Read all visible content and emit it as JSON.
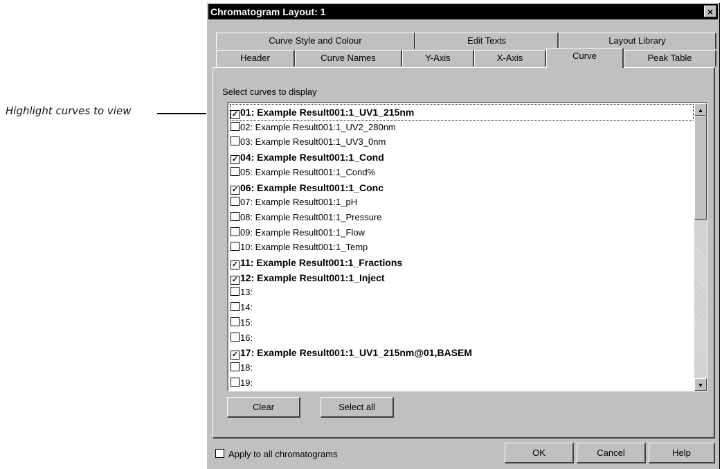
{
  "annotation": {
    "text": "Highlight curves to view"
  },
  "dialog": {
    "title": "Chromatogram Layout: 1",
    "close_label": "×",
    "tabs_back": [
      {
        "label": "Curve Style and Colour"
      },
      {
        "label": "Edit Texts"
      },
      {
        "label": "Layout Library"
      }
    ],
    "tabs_front": [
      {
        "label": "Header"
      },
      {
        "label": "Curve Names"
      },
      {
        "label": "Y-Axis"
      },
      {
        "label": "X-Axis"
      },
      {
        "label": "Curve",
        "active": true
      },
      {
        "label": "Peak Table"
      }
    ],
    "list_label": "Select curves to display",
    "curves": [
      {
        "label": "01: Example Result001:1_UV1_215nm",
        "checked": true
      },
      {
        "label": "02: Example Result001:1_UV2_280nm",
        "checked": false
      },
      {
        "label": "03: Example Result001:1_UV3_0nm",
        "checked": false
      },
      {
        "label": "04: Example Result001:1_Cond",
        "checked": true
      },
      {
        "label": "05: Example Result001:1_Cond%",
        "checked": false
      },
      {
        "label": "06: Example Result001:1_Conc",
        "checked": true
      },
      {
        "label": "07: Example Result001:1_pH",
        "checked": false
      },
      {
        "label": "08: Example Result001:1_Pressure",
        "checked": false
      },
      {
        "label": "09: Example Result001:1_Flow",
        "checked": false
      },
      {
        "label": "10: Example Result001:1_Temp",
        "checked": false
      },
      {
        "label": "11: Example Result001:1_Fractions",
        "checked": true
      },
      {
        "label": "12: Example Result001:1_Inject",
        "checked": true
      },
      {
        "label": "13:",
        "checked": false
      },
      {
        "label": "14:",
        "checked": false
      },
      {
        "label": "15:",
        "checked": false
      },
      {
        "label": "16:",
        "checked": false
      },
      {
        "label": "17: Example Result001:1_UV1_215nm@01,BASEM",
        "checked": true
      },
      {
        "label": "18:",
        "checked": false
      },
      {
        "label": "19:",
        "checked": false
      }
    ],
    "clear_label": "Clear",
    "select_all_label": "Select all",
    "apply_all_label": "Apply to all chromatograms",
    "apply_all_checked": false,
    "ok_label": "OK",
    "cancel_label": "Cancel",
    "help_label": "Help",
    "scroll_up_icon": "arrow-up-icon",
    "scroll_down_icon": "arrow-down-icon"
  }
}
